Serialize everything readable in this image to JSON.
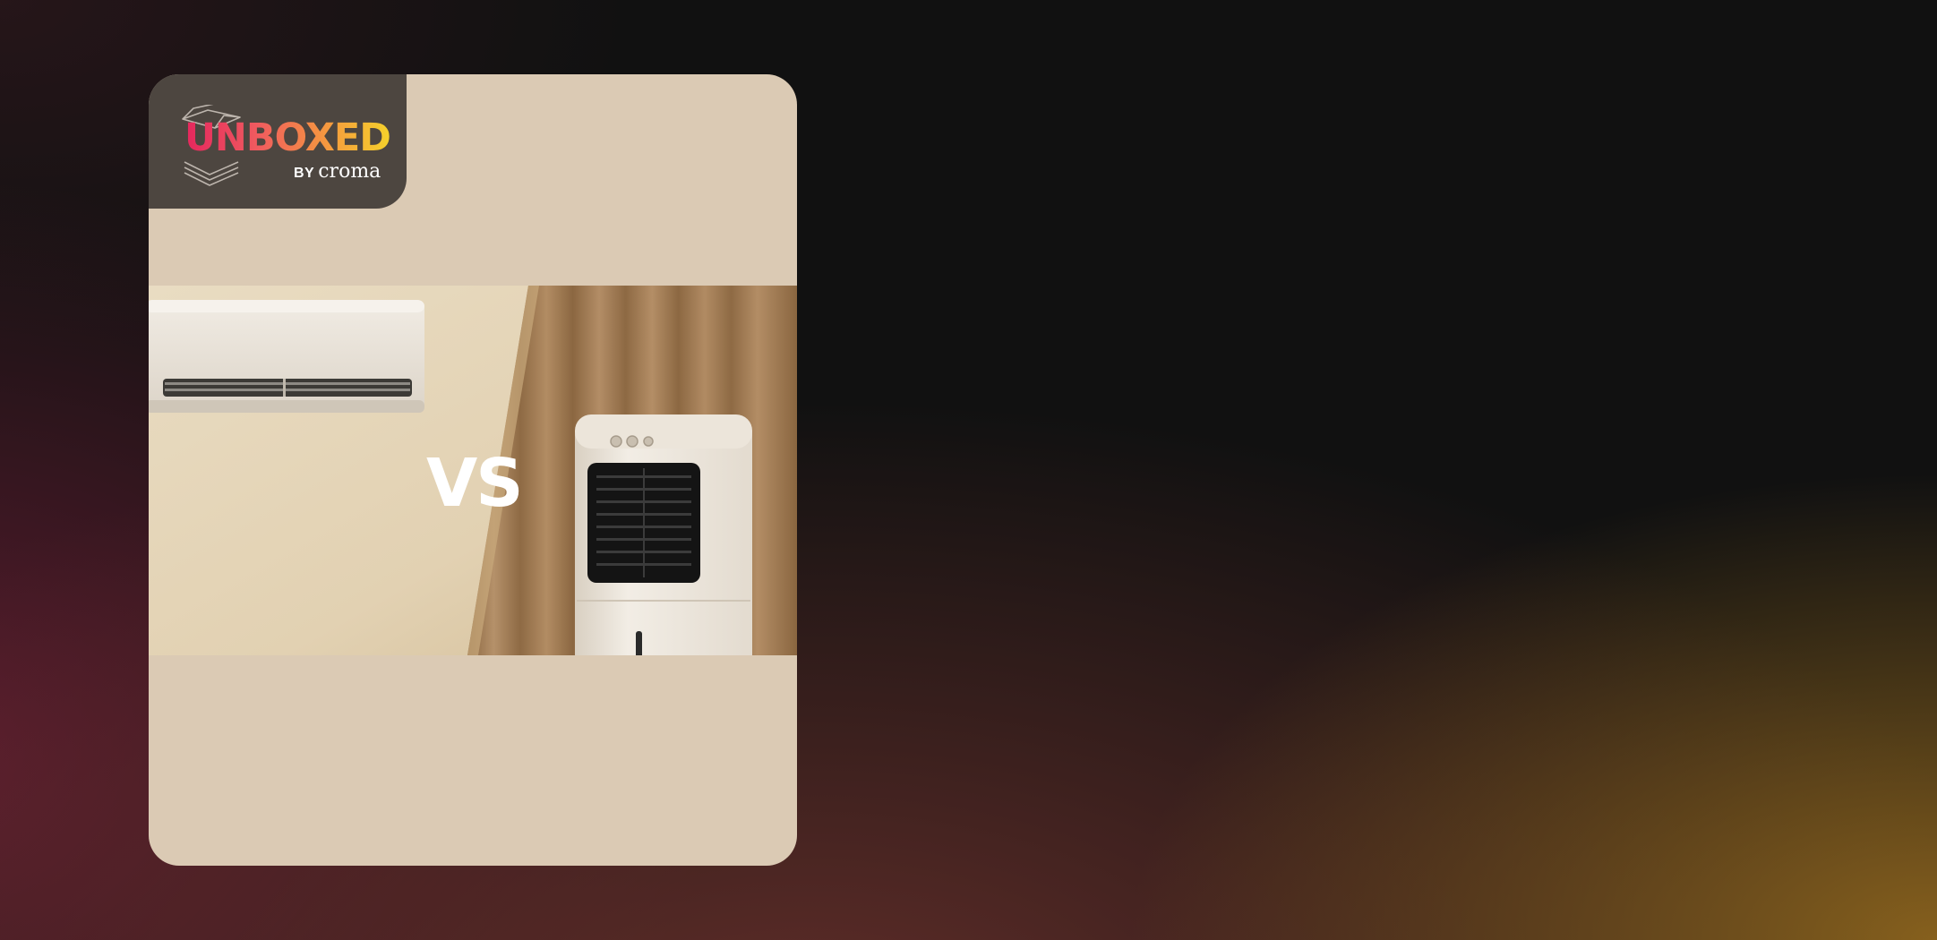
{
  "logo": {
    "word": "UNBOXED",
    "by": "BY",
    "brand": "croma"
  },
  "hero": {
    "versus_text": "VS",
    "left_product": "air-conditioner",
    "right_product": "air-cooler"
  },
  "colors": {
    "card_background": "#dbcab4",
    "logo_background": "#4d4640",
    "logo_gradient_start": "#e5265d",
    "logo_gradient_end": "#f5d22b",
    "curtain": "#a07a4e"
  },
  "icons": [
    "box-icon"
  ]
}
